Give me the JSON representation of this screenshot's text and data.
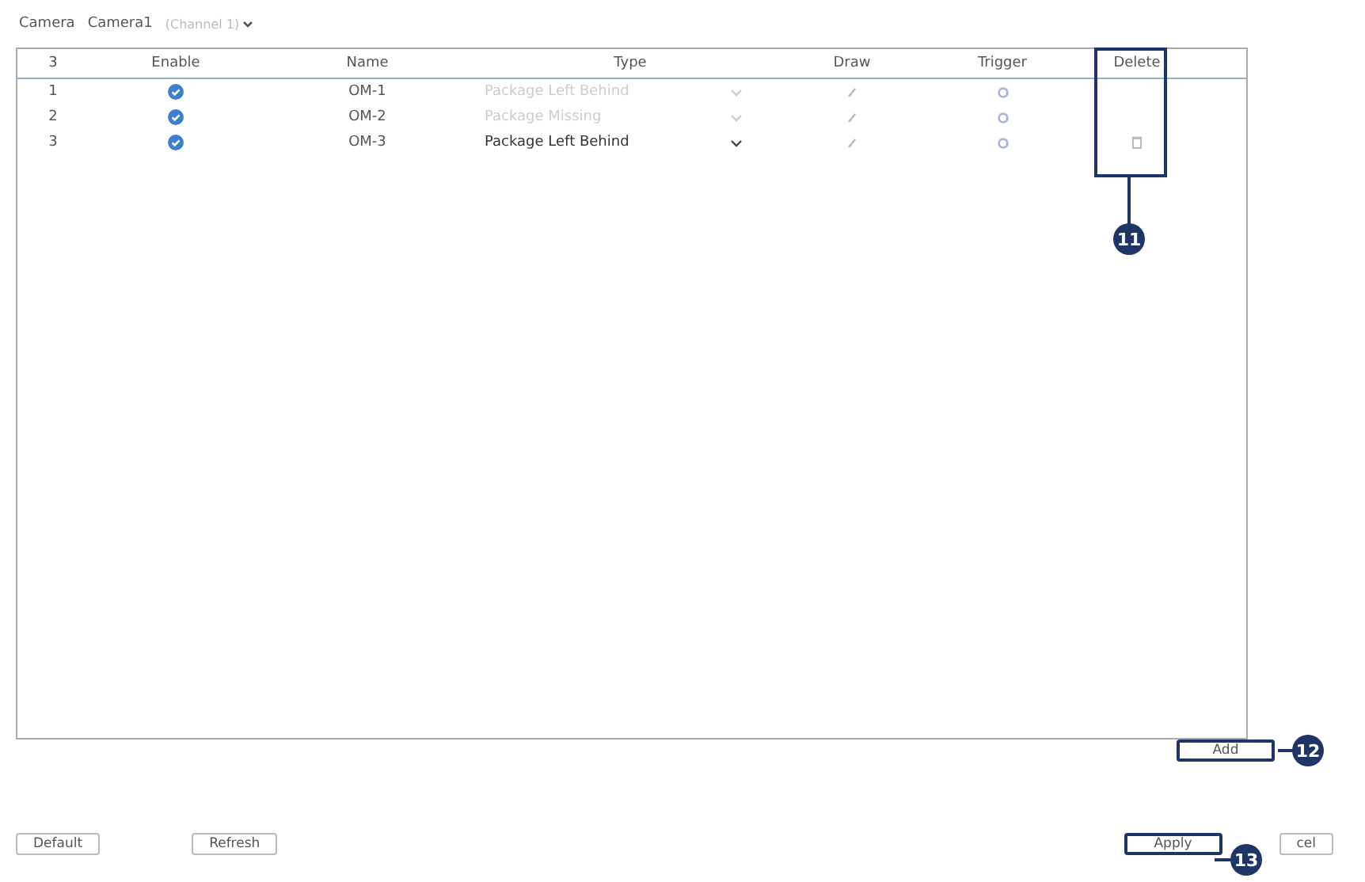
{
  "camera": {
    "label": "Camera",
    "value": "Camera1",
    "channel": "(Channel 1)"
  },
  "table": {
    "columns": [
      "3",
      "Enable",
      "Name",
      "Type",
      "Draw",
      "Trigger",
      "Delete"
    ],
    "rows": [
      {
        "index": "1",
        "enabled": true,
        "name": "OM-1",
        "type": "Package Left Behind",
        "type_editable": false,
        "deletable": false
      },
      {
        "index": "2",
        "enabled": true,
        "name": "OM-2",
        "type": "Package Missing",
        "type_editable": false,
        "deletable": false
      },
      {
        "index": "3",
        "enabled": true,
        "name": "OM-3",
        "type": "Package Left Behind",
        "type_editable": true,
        "deletable": true
      }
    ]
  },
  "add_button": "Add",
  "buttons": [
    "Default",
    "Refresh"
  ],
  "apply_button": "Apply",
  "cancel_button_visible_text": "cel",
  "callouts": [
    "11",
    "12",
    "13"
  ]
}
